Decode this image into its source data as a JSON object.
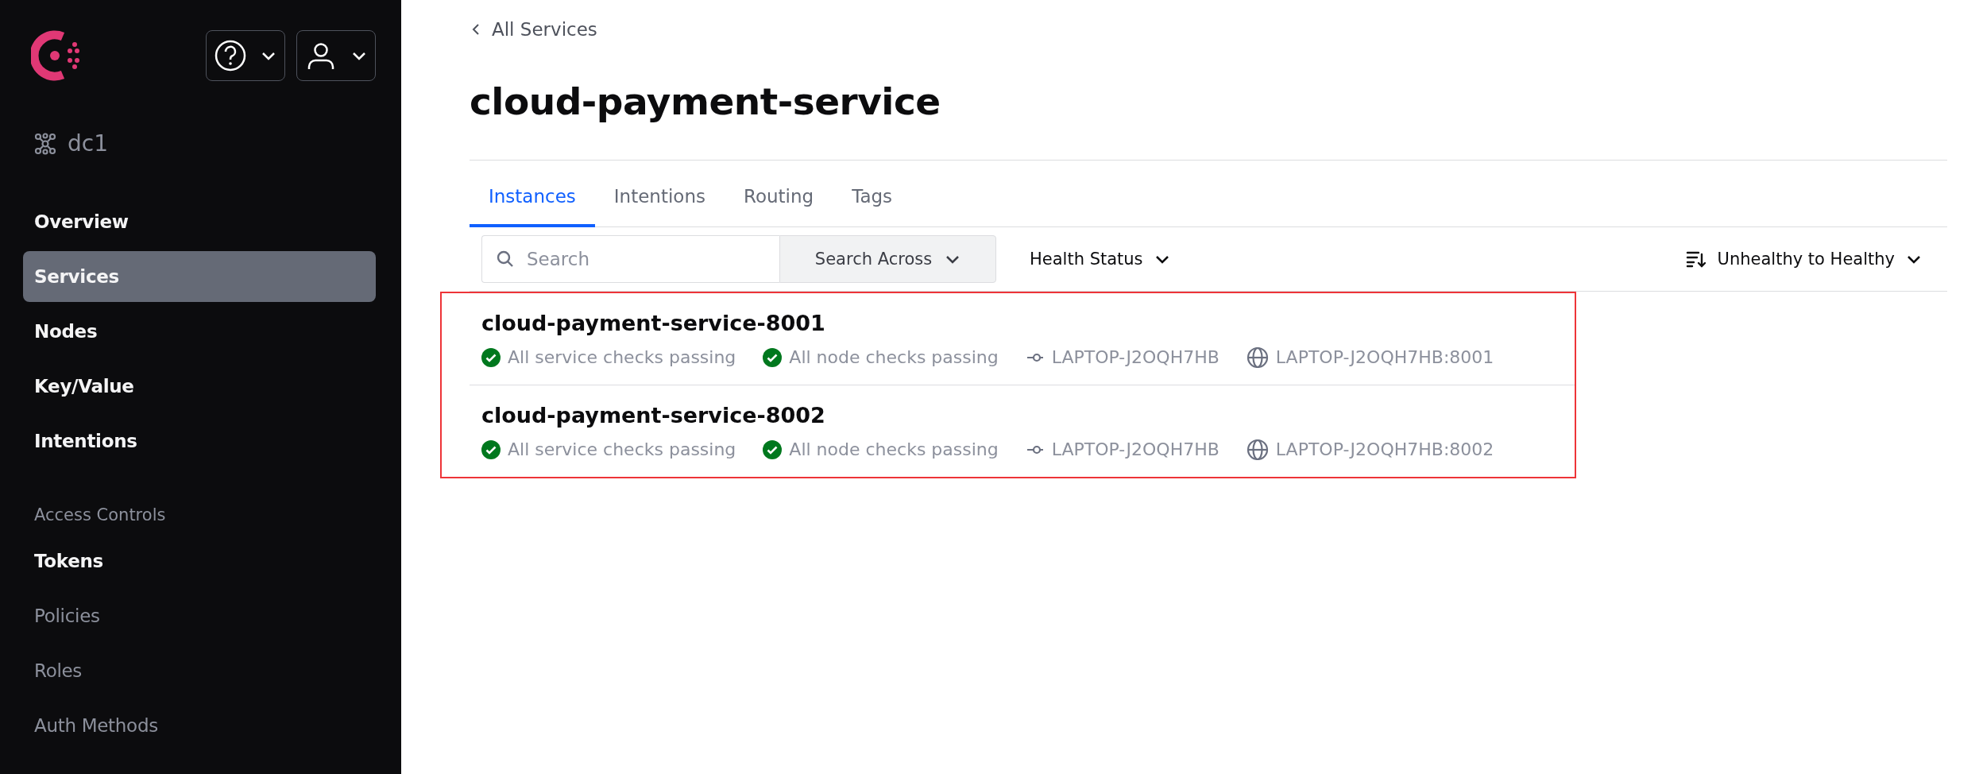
{
  "sidebar": {
    "datacenter": "dc1",
    "nav": [
      {
        "label": "Overview",
        "selected": false
      },
      {
        "label": "Services",
        "selected": true
      },
      {
        "label": "Nodes",
        "selected": false
      },
      {
        "label": "Key/Value",
        "selected": false
      },
      {
        "label": "Intentions",
        "selected": false
      }
    ],
    "section_title": "Access Controls",
    "acl_items": [
      {
        "label": "Tokens",
        "disabled": false
      },
      {
        "label": "Policies",
        "disabled": true
      },
      {
        "label": "Roles",
        "disabled": true
      },
      {
        "label": "Auth Methods",
        "disabled": true
      }
    ]
  },
  "breadcrumb": "All Services",
  "title": "cloud-payment-service",
  "tabs": [
    {
      "label": "Instances",
      "selected": true
    },
    {
      "label": "Intentions",
      "selected": false
    },
    {
      "label": "Routing",
      "selected": false
    },
    {
      "label": "Tags",
      "selected": false
    }
  ],
  "filters": {
    "search": {
      "placeholder": "Search"
    },
    "search_across": "Search Across",
    "health_status": "Health Status",
    "sort": "Unhealthy to Healthy"
  },
  "instances": {
    "highlighted": true,
    "rows": [
      {
        "name": "cloud-payment-service-8001",
        "service_checks": "All service checks passing",
        "node_checks": "All node checks passing",
        "node": "LAPTOP-J2OQH7HB",
        "address": "LAPTOP-J2OQH7HB:8001"
      },
      {
        "name": "cloud-payment-service-8002",
        "service_checks": "All service checks passing",
        "node_checks": "All node checks passing",
        "node": "LAPTOP-J2OQH7HB",
        "address": "LAPTOP-J2OQH7HB:8002"
      }
    ]
  }
}
